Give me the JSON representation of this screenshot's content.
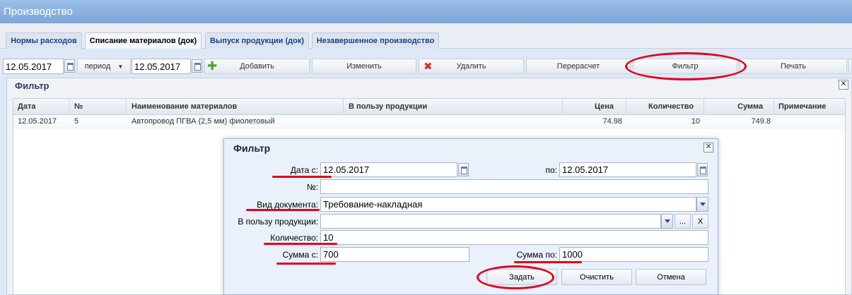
{
  "window": {
    "title": "Производство"
  },
  "tabs": [
    {
      "label": "Нормы расходов"
    },
    {
      "label": "Списание материалов (док)"
    },
    {
      "label": "Выпуск продукции (док)"
    },
    {
      "label": "Незавершенное производство"
    }
  ],
  "toolbar": {
    "date_from": "12.05.2017",
    "period_label": "период",
    "date_to": "12.05.2017",
    "add": "Добавить",
    "edit": "Изменить",
    "delete": "Удалить",
    "recalc": "Перерасчет",
    "filter": "Фильтр",
    "print": "Печать"
  },
  "panel": {
    "title": "Фильтр",
    "close_glyph": "✕",
    "columns": [
      "Дата",
      "№",
      "Наименование материалов",
      "В пользу продукции",
      "Цена",
      "Количество",
      "Сумма",
      "Примечание"
    ],
    "rows": [
      {
        "date": "12.05.2017",
        "num": "5",
        "material": "Автопровод ПГВА (2,5 мм) фиолетовый",
        "product": "",
        "price": "74.98",
        "qty": "10",
        "sum": "749.8",
        "note": ""
      }
    ]
  },
  "dialog": {
    "title": "Фильтр",
    "close_glyph": "✕",
    "date_from_label": "Дата с:",
    "date_from": "12.05.2017",
    "date_to_label": "по:",
    "date_to": "12.05.2017",
    "num_label": "№:",
    "num_value": "",
    "doctype_label": "Вид документа:",
    "doctype_value": "Требование-накладная",
    "product_label": "В пользу продукции:",
    "product_value": "",
    "ellipsis_button": "...",
    "clear_x_button": "X",
    "qty_label": "Количество:",
    "qty_value": "10",
    "sum_from_label": "Сумма с:",
    "sum_from": "700",
    "sum_to_label": "Сумма по:",
    "sum_to": "1000",
    "apply": "Задать",
    "clear": "Очистить",
    "cancel": "Отмена"
  },
  "colors": {
    "annotation": "#e0001b",
    "titlebar": "#7aa6d8"
  }
}
